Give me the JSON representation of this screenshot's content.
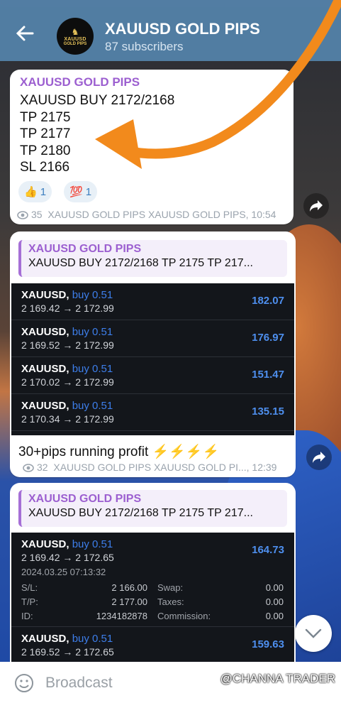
{
  "header": {
    "title": "XAUUSD GOLD PIPS",
    "subtitle": "87 subscribers",
    "avatar_line1": "XAUUSD",
    "avatar_line2": "GOLD PIPS"
  },
  "post1": {
    "author": "XAUUSD GOLD PIPS",
    "lines": [
      "XAUUSD BUY 2172/2168",
      "TP 2175",
      "TP 2177",
      "TP 2180",
      "SL 2166"
    ],
    "reactions": [
      {
        "emoji": "👍",
        "count": "1"
      },
      {
        "emoji": "💯",
        "count": "1"
      }
    ],
    "views": "35",
    "meta": "XAUUSD GOLD PIPS XAUUSD GOLD PIPS, 10:54"
  },
  "post2": {
    "reply_name": "XAUUSD GOLD PIPS",
    "reply_text": "XAUUSD BUY 2172/2168 TP 2175 TP 217...",
    "trades": [
      {
        "sym": "XAUUSD,",
        "side": "buy 0.51",
        "prices": "2 169.42 → 2 172.99",
        "profit": "182.07"
      },
      {
        "sym": "XAUUSD,",
        "side": "buy 0.51",
        "prices": "2 169.52 → 2 172.99",
        "profit": "176.97"
      },
      {
        "sym": "XAUUSD,",
        "side": "buy 0.51",
        "prices": "2 170.02 → 2 172.99",
        "profit": "151.47"
      },
      {
        "sym": "XAUUSD,",
        "side": "buy 0.51",
        "prices": "2 170.34 → 2 172.99",
        "profit": "135.15"
      }
    ],
    "caption": "30+pips running profit ⚡⚡⚡⚡",
    "views": "32",
    "meta": "XAUUSD GOLD PIPS XAUUSD GOLD PI..., 12:39"
  },
  "post3": {
    "reply_name": "XAUUSD GOLD PIPS",
    "reply_text": "XAUUSD BUY 2172/2168 TP 2175 TP 217...",
    "trade1": {
      "sym": "XAUUSD,",
      "side": "buy 0.51",
      "prices": "2 169.42 → 2 172.65",
      "profit": "164.73",
      "date": "2024.03.25 07:13:32",
      "sl_label": "S/L:",
      "sl": "2 166.00",
      "swap_label": "Swap:",
      "swap": "0.00",
      "tp_label": "T/P:",
      "tp": "2 177.00",
      "taxes_label": "Taxes:",
      "taxes": "0.00",
      "id_label": "ID:",
      "id": "1234182878",
      "comm_label": "Commission:",
      "comm": "0.00"
    },
    "trade2": {
      "sym": "XAUUSD,",
      "side": "buy 0.51",
      "prices": "2 169.52 → 2 172.65",
      "profit": "159.63"
    }
  },
  "input": {
    "placeholder": "Broadcast"
  },
  "watermark": "@CHANNA TRADER",
  "colors": {
    "header": "#517da2",
    "accent": "#9c5fd0",
    "arrow": "#f28a1c",
    "profit": "#4e8fee"
  }
}
